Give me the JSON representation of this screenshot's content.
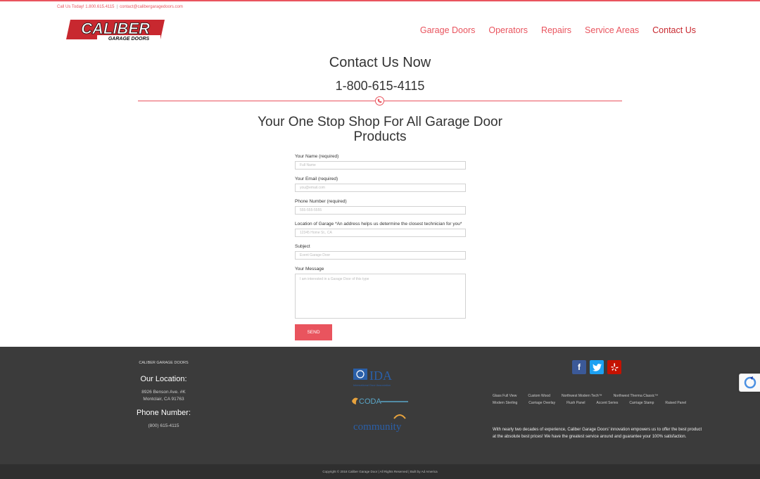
{
  "topbar": {
    "call": "Call Us Today! 1.800.615.4115",
    "separator": "|",
    "email": "contact@calibergaragedoors.com"
  },
  "logo": {
    "main": "CALIBER",
    "sub": "GARAGE DOORS"
  },
  "nav": [
    "Garage Doors",
    "Operators",
    "Repairs",
    "Service Areas",
    "Contact Us"
  ],
  "hero": {
    "title": "Contact Us Now",
    "phone": "1-800-615-4115"
  },
  "section_title": "Your One Stop Shop For All Garage Door Products",
  "form": {
    "name_label": "Your Name (required)",
    "name_placeholder": "Full Name",
    "email_label": "Your Email (required)",
    "email_placeholder": "you@email.com",
    "phone_label": "Phone Number (required)",
    "phone_placeholder": "555-555-5555",
    "location_label": "Location of Garage *An address helps us determine the closest technician for you*",
    "location_placeholder": "12345 Home St., CA",
    "subject_label": "Subject",
    "subject_placeholder": "Event Garage Door",
    "message_label": "Your Message",
    "message_placeholder": "I am interested in a Garage Door of this type",
    "send": "SEND"
  },
  "footer": {
    "brand": "CALIBER GARAGE DOORS",
    "location_heading": "Our Location:",
    "address1": "8926 Benson Ave. #K",
    "address2": "Montclair, CA 91763",
    "phone_heading": "Phone Number:",
    "phone": "(800) 615-4115",
    "logos": {
      "ida": "IDA",
      "ida_sub": "International Door Association",
      "coda": "CODA",
      "community": "community"
    },
    "social": [
      "facebook-icon",
      "twitter-icon",
      "yelp-icon"
    ],
    "tags": [
      "Glass Full View",
      "Custom Wood",
      "Northwest Modern Tech™",
      "Northwest Therma Classic™",
      "Modern Sterling",
      "Carriage Overlay",
      "Flush Panel",
      "Accent Series",
      "Carriage Stamp",
      "Raised Panel"
    ],
    "about": "With nearly two decades of experience, Caliber Garage Doors' innovation empowers us to offer the best product at the absolute best prices! We have the greatest service around and guarantee your 100% satisfaction.",
    "copyright": "Copyright © 2018 Caliber Garage Door | All Rights Reserved | Built by Ad America"
  },
  "colors": {
    "accent": "#e9545e",
    "footer_bg": "#3b3b3b",
    "facebook": "#3b5998",
    "twitter": "#1da1f2",
    "yelp": "#c41200"
  }
}
